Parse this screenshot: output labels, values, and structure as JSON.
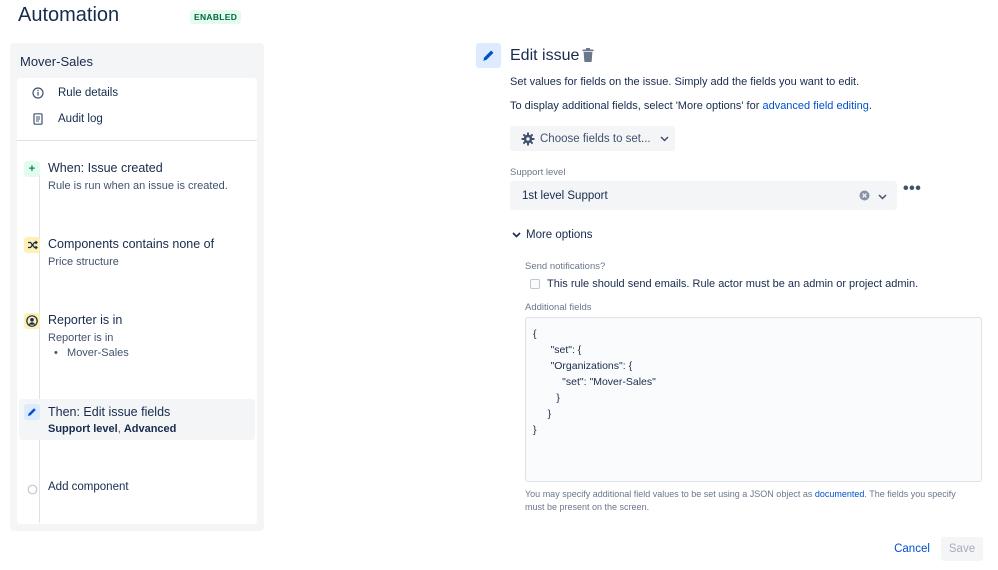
{
  "header": {
    "title": "Automation",
    "status_badge": "ENABLED"
  },
  "sidebar": {
    "rule_name": "Mover-Sales",
    "menu": [
      {
        "label": "Rule details",
        "icon": "info-icon"
      },
      {
        "label": "Audit log",
        "icon": "document-icon"
      }
    ],
    "steps": [
      {
        "icon": "plus-icon",
        "title": "When: Issue created",
        "subtitle": "Rule is run when an issue is created."
      },
      {
        "icon": "shuffle-icon",
        "title": "Components contains none of",
        "subtitle": "Price structure"
      },
      {
        "icon": "user-circle-icon",
        "title": "Reporter is in",
        "subtitle": "Reporter is in",
        "bullets": [
          "Mover-Sales"
        ]
      },
      {
        "icon": "pencil-icon",
        "title": "Then: Edit issue fields",
        "subtitle_bold_1": "Support level",
        "subtitle_sep": ", ",
        "subtitle_bold_2": "Advanced"
      },
      {
        "icon": "empty-circle-icon",
        "title": "Add component"
      }
    ]
  },
  "editor": {
    "title": "Edit issue",
    "desc1": "Set values for fields on the issue. Simply add the fields you want to edit.",
    "desc2_prefix": "To display additional fields, select 'More options' for ",
    "desc2_link": "advanced field editing",
    "desc2_suffix": ".",
    "choose_fields_label": "Choose fields to set...",
    "support_level_label": "Support level",
    "support_level_value": "1st level Support",
    "more_options_label": "More options",
    "send_notifications_label": "Send notifications?",
    "send_notifications_checkbox": "This rule should send emails. Rule actor must be an admin or project admin.",
    "send_notifications_checked": false,
    "additional_fields_label": "Additional fields",
    "additional_fields_value": "{\n      \"set\": {\n      \"Organizations\": {\n          \"set\": \"Mover-Sales\"\n        }\n     }\n}",
    "help_prefix": "You may specify additional field values to be set using a JSON object as ",
    "help_link": "documented",
    "help_suffix": ". The fields you specify must be present on the screen."
  },
  "footer": {
    "cancel_label": "Cancel",
    "save_label": "Save"
  },
  "colors": {
    "accent": "#0052cc",
    "enabled_bg": "#e3fcef",
    "enabled_text": "#006644",
    "panel_bg": "#f4f5f7"
  }
}
